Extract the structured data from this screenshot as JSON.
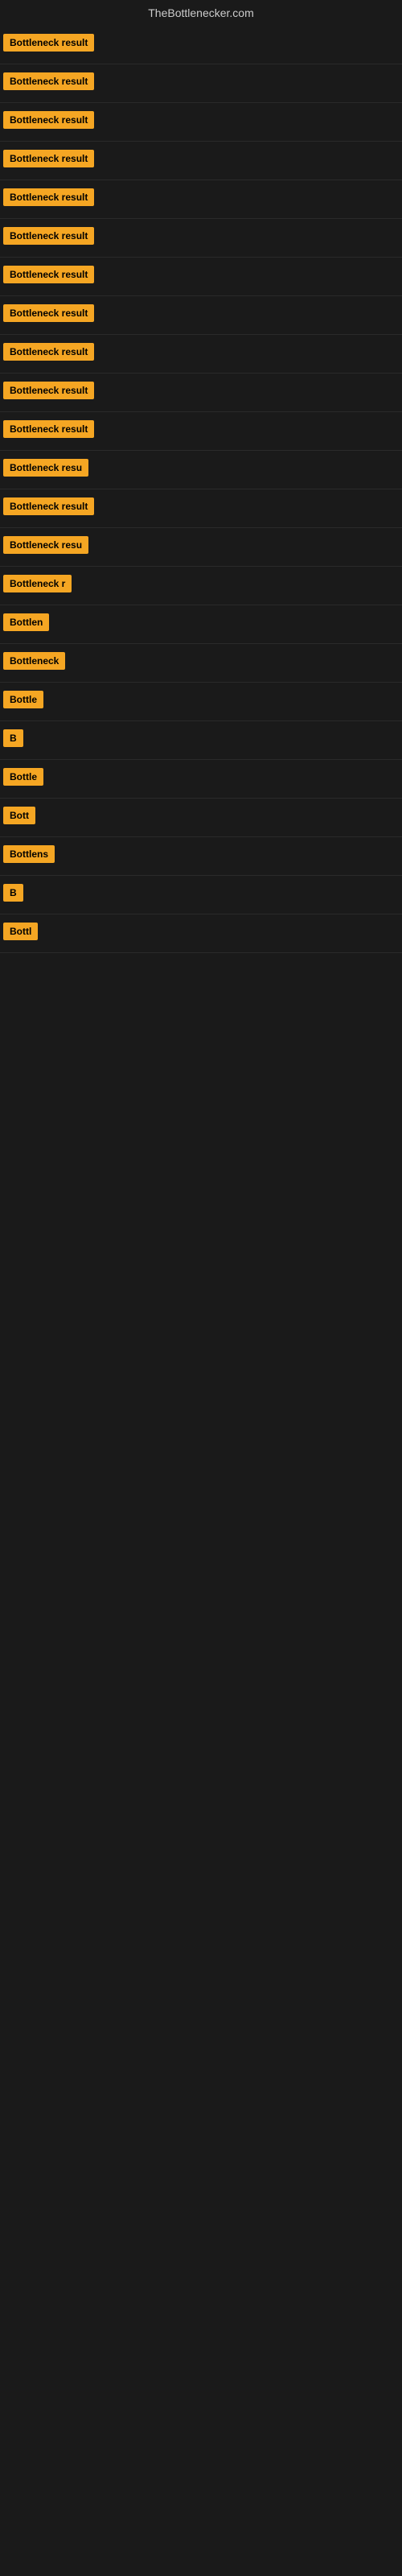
{
  "site": {
    "title": "TheBottlenecker.com"
  },
  "results": [
    {
      "id": 1,
      "label": "Bottleneck result",
      "visible_chars": 16
    },
    {
      "id": 2,
      "label": "Bottleneck result",
      "visible_chars": 16
    },
    {
      "id": 3,
      "label": "Bottleneck result",
      "visible_chars": 16
    },
    {
      "id": 4,
      "label": "Bottleneck result",
      "visible_chars": 16
    },
    {
      "id": 5,
      "label": "Bottleneck result",
      "visible_chars": 16
    },
    {
      "id": 6,
      "label": "Bottleneck result",
      "visible_chars": 16
    },
    {
      "id": 7,
      "label": "Bottleneck result",
      "visible_chars": 16
    },
    {
      "id": 8,
      "label": "Bottleneck result",
      "visible_chars": 16
    },
    {
      "id": 9,
      "label": "Bottleneck result",
      "visible_chars": 16
    },
    {
      "id": 10,
      "label": "Bottleneck result",
      "visible_chars": 16
    },
    {
      "id": 11,
      "label": "Bottleneck result",
      "visible_chars": 16
    },
    {
      "id": 12,
      "label": "Bottleneck resu",
      "visible_chars": 15
    },
    {
      "id": 13,
      "label": "Bottleneck result",
      "visible_chars": 16
    },
    {
      "id": 14,
      "label": "Bottleneck resu",
      "visible_chars": 15
    },
    {
      "id": 15,
      "label": "Bottleneck r",
      "visible_chars": 12
    },
    {
      "id": 16,
      "label": "Bottlen",
      "visible_chars": 7
    },
    {
      "id": 17,
      "label": "Bottleneck",
      "visible_chars": 10
    },
    {
      "id": 18,
      "label": "Bottle",
      "visible_chars": 6
    },
    {
      "id": 19,
      "label": "B",
      "visible_chars": 1
    },
    {
      "id": 20,
      "label": "Bottle",
      "visible_chars": 6
    },
    {
      "id": 21,
      "label": "Bott",
      "visible_chars": 4
    },
    {
      "id": 22,
      "label": "Bottlens",
      "visible_chars": 8
    },
    {
      "id": 23,
      "label": "B",
      "visible_chars": 1
    },
    {
      "id": 24,
      "label": "Bottl",
      "visible_chars": 5
    }
  ]
}
